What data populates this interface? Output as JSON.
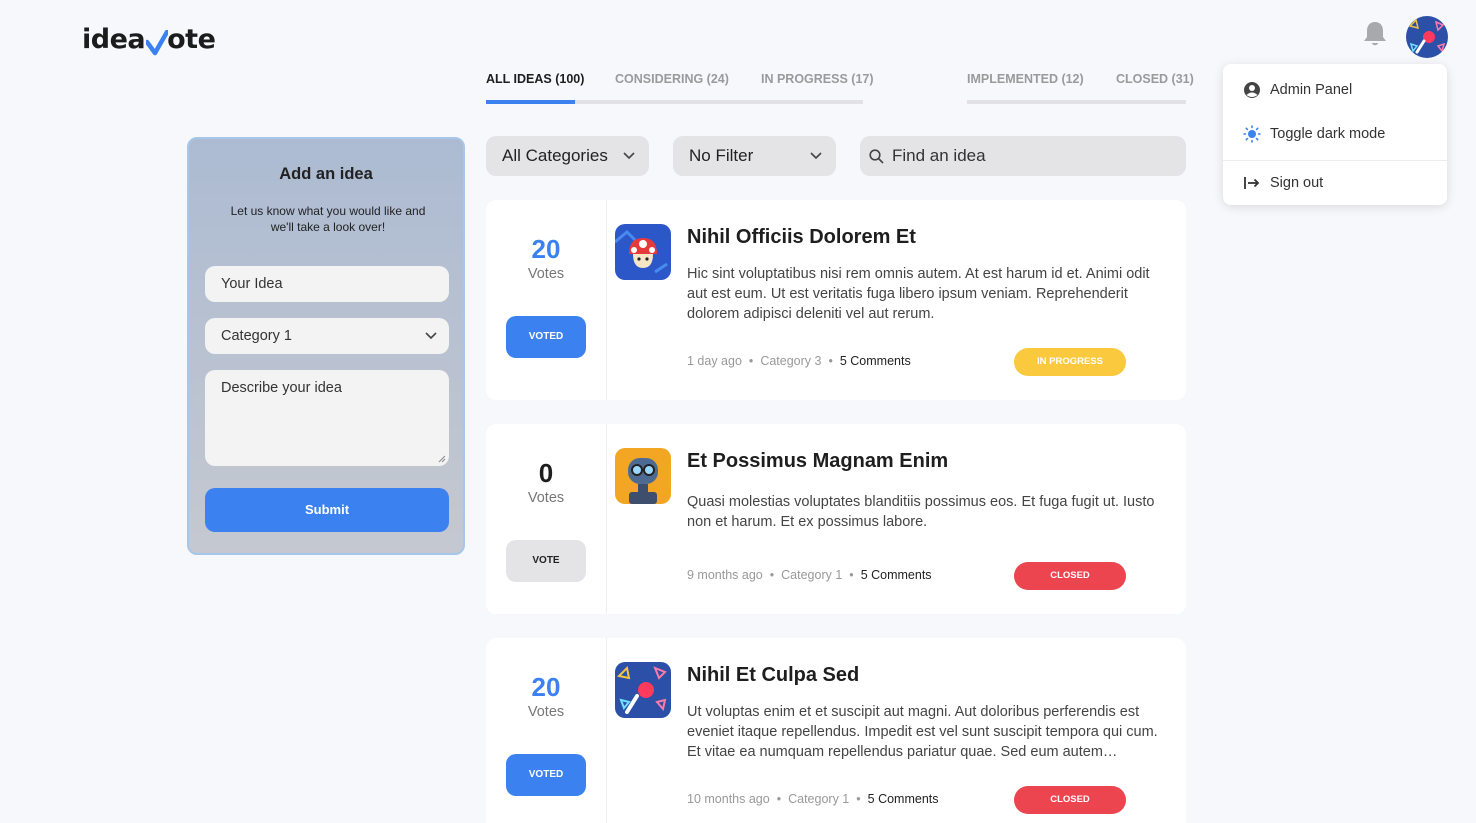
{
  "app": {
    "name": "ideavote",
    "logo_left": "idea",
    "logo_right": "ote"
  },
  "header": {
    "notification_icon": "bell-icon",
    "avatar_icon": "avatar"
  },
  "user_menu": {
    "items": [
      {
        "label": "Admin Panel",
        "icon": "user-circle-icon"
      },
      {
        "label": "Toggle dark mode",
        "icon": "sun-icon"
      },
      {
        "label": "Sign out",
        "icon": "sign-out-icon"
      }
    ]
  },
  "tabs": [
    {
      "label": "ALL IDEAS (100)",
      "active": true
    },
    {
      "label": "CONSIDERING (24)",
      "active": false
    },
    {
      "label": "IN PROGRESS (17)",
      "active": false
    },
    {
      "label": "IMPLEMENTED (12)",
      "active": false
    },
    {
      "label": "CLOSED (31)",
      "active": false
    }
  ],
  "add_idea": {
    "title": "Add an idea",
    "subtitle": "Let us know what you would like and we'll take a look over!",
    "idea_placeholder": "Your Idea",
    "category_value": "Category 1",
    "description_placeholder": "Describe your idea",
    "submit_label": "Submit"
  },
  "filters": {
    "category": "All Categories",
    "filter": "No Filter",
    "search_placeholder": "Find an idea"
  },
  "ideas": [
    {
      "votes": "20",
      "votes_label": "Votes",
      "vote_button": "VOTED",
      "voted": true,
      "title": "Nihil Officiis Dolorem Et",
      "description": "Hic sint voluptatibus nisi rem omnis autem. At est harum id et. Animi odit aut est eum. Ut est veritatis fuga libero ipsum veniam. Reprehenderit dolorem adipisci deleniti vel aut rerum.",
      "time": "1 day ago",
      "category": "Category 3",
      "comments": "5 Comments",
      "status": "IN PROGRESS",
      "status_color": "#fbc93d"
    },
    {
      "votes": "0",
      "votes_label": "Votes",
      "vote_button": "VOTE",
      "voted": false,
      "title": "Et Possimus Magnam Enim",
      "description": "Quasi molestias voluptates blanditiis possimus eos. Et fuga fugit ut. Iusto non et harum. Et ex possimus labore.",
      "time": "9 months ago",
      "category": "Category 1",
      "comments": "5 Comments",
      "status": "CLOSED",
      "status_color": "#ec454f"
    },
    {
      "votes": "20",
      "votes_label": "Votes",
      "vote_button": "VOTED",
      "voted": true,
      "title": "Nihil Et Culpa Sed",
      "description": "Ut voluptas enim et et suscipit aut magni. Aut doloribus perferendis est eveniet itaque repellendus. Impedit est vel sunt suscipit tempora qui cum. Et vitae ea numquam repellendus pariatur quae. Sed eum autem…",
      "time": "10 months ago",
      "category": "Category 1",
      "comments": "5 Comments",
      "status": "CLOSED",
      "status_color": "#ec454f"
    }
  ],
  "colors": {
    "accent": "#3b82f0",
    "in_progress": "#fbc93d",
    "closed": "#ec454f",
    "voted_count": "#3b82f0"
  }
}
